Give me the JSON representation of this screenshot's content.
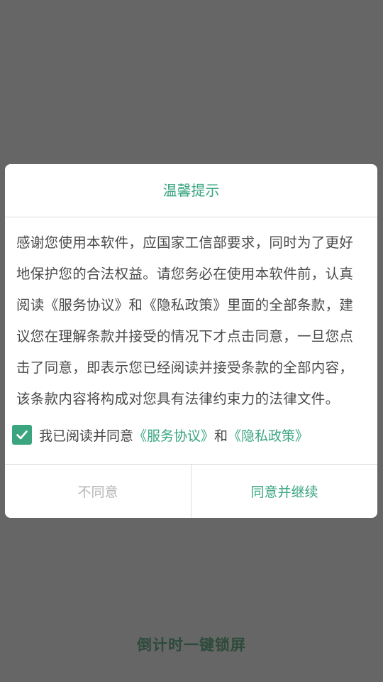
{
  "dialog": {
    "title": "温馨提示",
    "body": "感谢您使用本软件，应国家工信部要求，同时为了更好地保护您的合法权益。请您务必在使用本软件前，认真阅读《服务协议》和《隐私政策》里面的全部条款，建议您在理解条款并接受的情况下才点击同意，一旦您点击了同意，即表示您已经阅读并接受条款的全部内容，该条款内容将构成对您具有法律约束力的法律文件。",
    "agree_prefix": "我已阅读并同意",
    "service_link": "《服务协议》",
    "and_text": "和",
    "privacy_link": "《隐私政策》",
    "checkbox_checked": true,
    "disagree_label": "不同意",
    "agree_label": "同意并继续"
  },
  "app": {
    "footer_title": "倒计时一键锁屏"
  },
  "colors": {
    "accent": "#3aa57f",
    "overlay": "#666666"
  },
  "icons": {
    "checkbox": "check-icon"
  }
}
